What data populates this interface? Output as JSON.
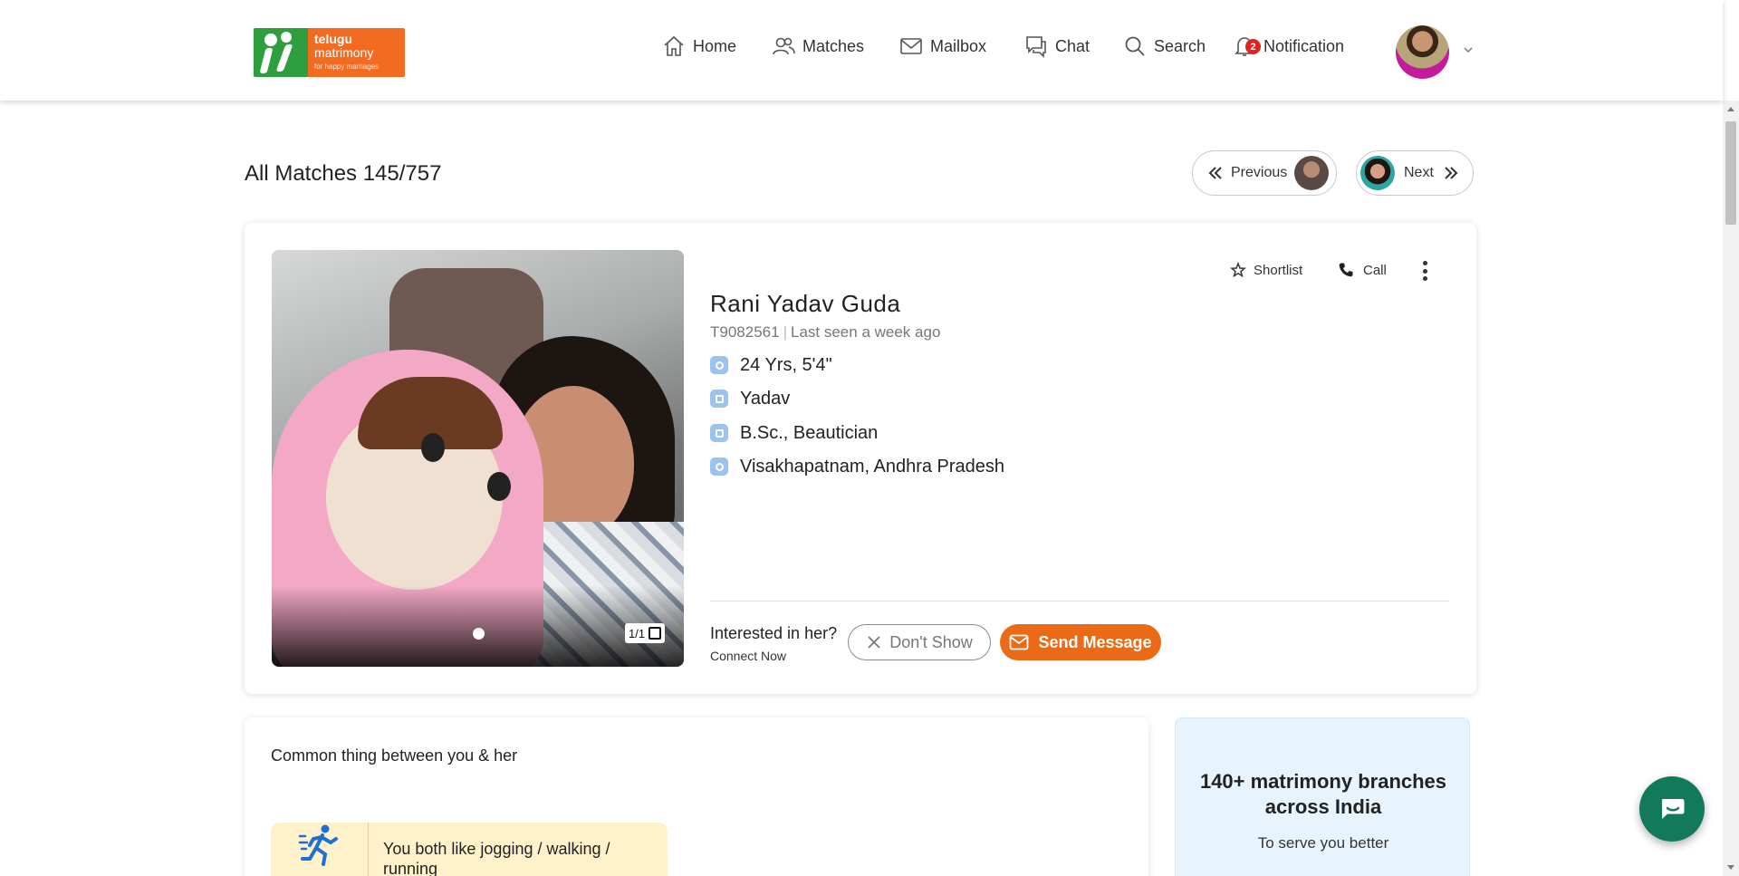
{
  "brand": {
    "line1": "telugu",
    "line2": "matrimony",
    "tagline": "for happy marriages",
    "orange": "#f26b21",
    "green": "#2e9e3f"
  },
  "nav": {
    "home": "Home",
    "matches": "Matches",
    "mailbox": "Mailbox",
    "chat": "Chat",
    "search": "Search",
    "notification": "Notification",
    "notification_count": "2"
  },
  "page": {
    "title": "All Matches 145/757",
    "previous": "Previous",
    "next": "Next"
  },
  "profile": {
    "name": "Rani Yadav Guda",
    "id": "T9082561",
    "last_seen": "Last seen a week ago",
    "age_height": "24 Yrs, 5'4\"",
    "community": "Yadav",
    "education_job": "B.Sc., Beautician",
    "location": "Visakhapatnam, Andhra Pradesh",
    "photo_counter": "1/1",
    "shortlist": "Shortlist",
    "call": "Call",
    "interest_question": "Interested in her?",
    "interest_sub": "Connect Now",
    "dont_show": "Don't Show",
    "send_message": "Send Message",
    "accent": "#ea6a16"
  },
  "common": {
    "heading": "Common thing between you & her",
    "hobby_text": "You both like jogging / walking / running",
    "hobby_icon": "running-icon"
  },
  "branches": {
    "title": "140+ matrimony branches across India",
    "subtitle": "To serve you better"
  }
}
